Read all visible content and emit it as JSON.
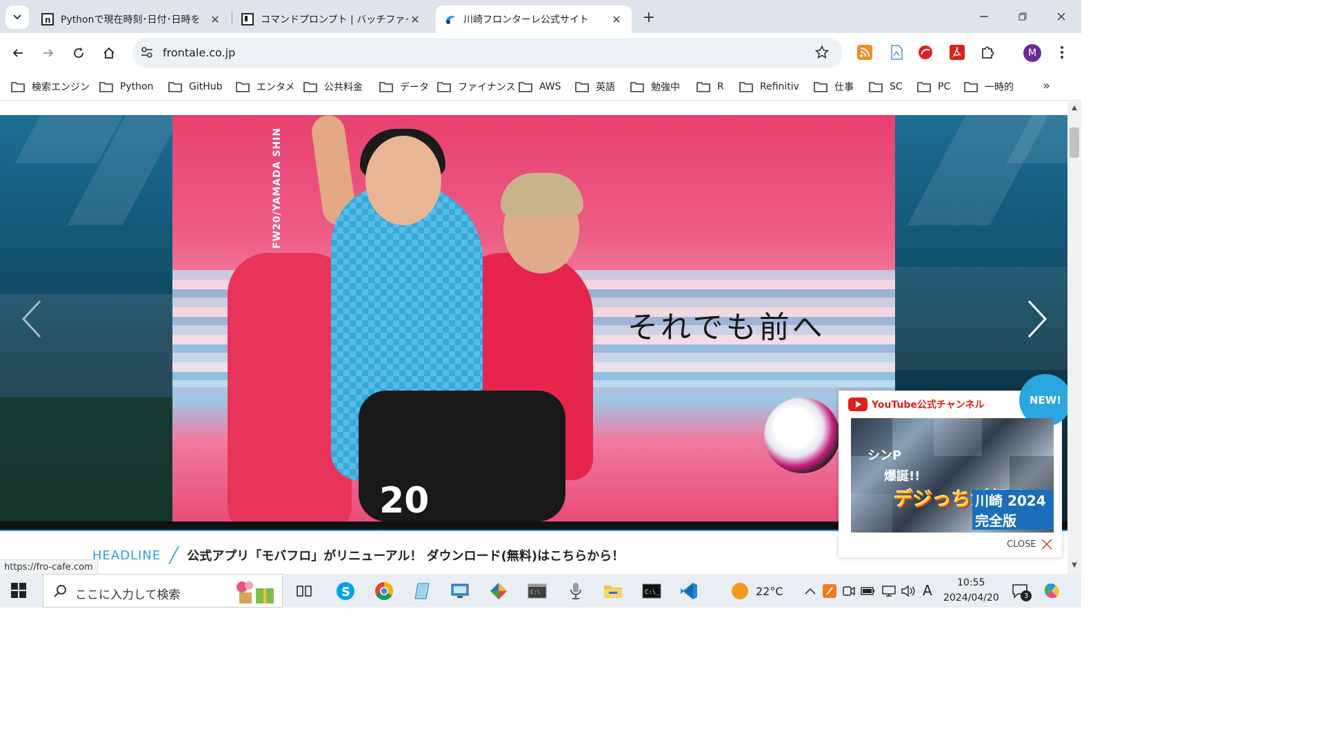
{
  "browser": {
    "tabs": [
      {
        "title": "Pythonで現在時刻･日付･日時を",
        "favicon": "n-icon",
        "active": false
      },
      {
        "title": "コマンドプロンプト | バッチファイルか",
        "favicon": "bookmark-doc-icon",
        "active": false
      },
      {
        "title": "川崎フロンターレ公式サイト",
        "favicon": "frontale-dolphin-icon",
        "active": true
      }
    ],
    "url": "frontale.co.jp",
    "profile_initial": "M",
    "bookmarks": [
      "検索エンジン",
      "Python",
      "GitHub",
      "エンタメ",
      "公共料金",
      "データ",
      "ファイナンス",
      "AWS",
      "英語",
      "勉強中",
      "R",
      "Refinitiv",
      "仕事",
      "SC",
      "PC",
      "一時的"
    ],
    "status_url": "https://fro-cafe.com"
  },
  "page": {
    "hero_vertical_text": "FW20/YAMADA SHIN",
    "hero_copy": "それでも前へ",
    "jersey_number": "20",
    "headline_label": "HEADLINE",
    "headline_text": "公式アプリ「モバフロ」がリニューアル！ ダウンロード(無料)はこちらから！",
    "youtube_popup": {
      "title": "YouTube公式チャンネル",
      "badge": "NEW!",
      "thumb_caption1": "シンP",
      "thumb_caption2": "爆誕!!",
      "thumb_title": "デジっちが行く!",
      "thumb_subtitle": "川崎 2024 完全版",
      "close_label": "CLOSE"
    }
  },
  "taskbar": {
    "search_placeholder": "ここに入力して検索",
    "weather": "22°C",
    "ime": "A",
    "time": "10:55",
    "date": "2024/04/20",
    "notification_count": "3"
  },
  "colors": {
    "accent": "#2aa0d8",
    "youtube_red": "#e0201a",
    "profile": "#6a2c91"
  }
}
